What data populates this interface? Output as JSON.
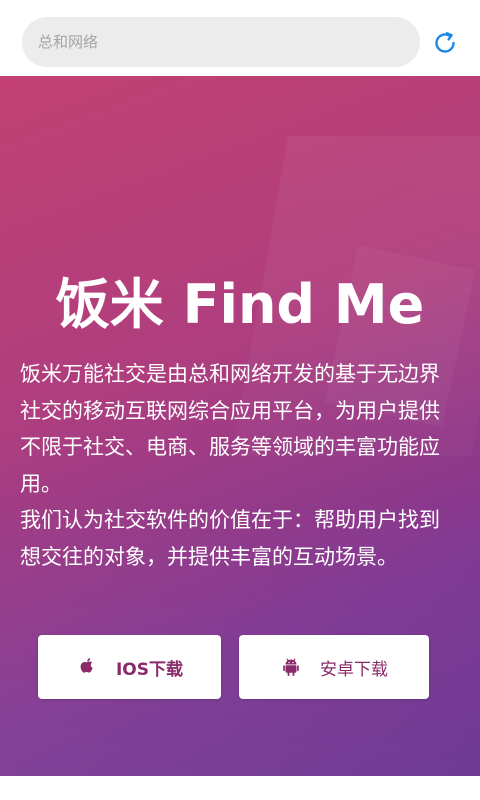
{
  "search": {
    "placeholder": "总和网络"
  },
  "hero": {
    "title": "饭米 Find Me",
    "description_1": "饭米万能社交是由总和网络开发的基于无边界社交的移动互联网综合应用平台，为用户提供不限于社交、电商、服务等领域的丰富功能应用。",
    "description_2": "我们认为社交软件的价值在于：帮助用户找到想交往的对象，并提供丰富的互动场景。"
  },
  "buttons": {
    "ios_label": "IOS下载",
    "android_label": "安卓下载"
  },
  "icons": {
    "refresh": "refresh-icon",
    "apple": "apple-icon",
    "android": "android-icon"
  },
  "colors": {
    "accent": "#1e88e5",
    "button_text": "#8a2a6a",
    "hero_top": "#c03a6c",
    "hero_bottom": "#60288a"
  }
}
